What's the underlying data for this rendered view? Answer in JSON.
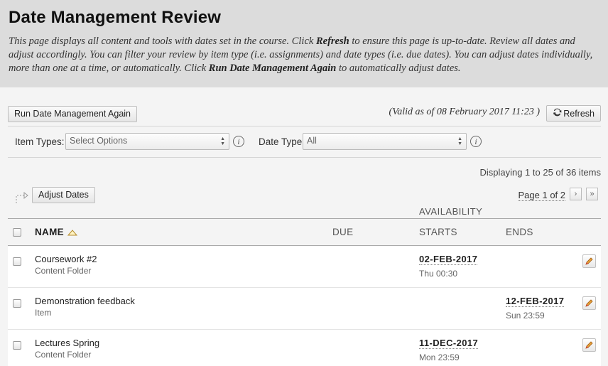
{
  "header": {
    "title": "Date Management Review",
    "desc_1": "This page displays all content and tools with dates set in the course. Click ",
    "desc_refresh": "Refresh",
    "desc_2": " to ensure this page is up-to-date. Review all dates and adjust accordingly. You can filter your review by item type (i.e. assignments) and date types (i.e. due dates). You can adjust dates individually, more than one at a time, or automatically. Click ",
    "desc_run": "Run Date Management Again",
    "desc_3": " to automatically adjust dates."
  },
  "toolbar": {
    "run_label": "Run Date Management Again",
    "valid_text": "(Valid as of 08 February 2017 11:23 )",
    "refresh_label": "Refresh"
  },
  "filters": {
    "item_types_label": "Item Types:",
    "item_types_value": "Select Options",
    "date_type_label": "Date Type",
    "date_type_value": "All"
  },
  "display_text": "Displaying 1 to 25 of 36 items",
  "adjust_label": "Adjust Dates",
  "pagination": {
    "text": "Page 1 of 2"
  },
  "table": {
    "group_header": "AVAILABILITY",
    "columns": {
      "name": "NAME",
      "due": "DUE",
      "starts": "STARTS",
      "ends": "ENDS"
    },
    "rows": [
      {
        "name": "Coursework #2",
        "type": "Content Folder",
        "due": "",
        "starts_date": "02-FEB-2017",
        "starts_time": "Thu 00:30",
        "ends_date": "",
        "ends_time": ""
      },
      {
        "name": "Demonstration feedback",
        "type": "Item",
        "due": "",
        "starts_date": "",
        "starts_time": "",
        "ends_date": "12-FEB-2017",
        "ends_time": "Sun 23:59"
      },
      {
        "name": "Lectures Spring",
        "type": "Content Folder",
        "due": "",
        "starts_date": "11-DEC-2017",
        "starts_time": "Mon 23:59",
        "ends_date": "",
        "ends_time": ""
      }
    ]
  }
}
